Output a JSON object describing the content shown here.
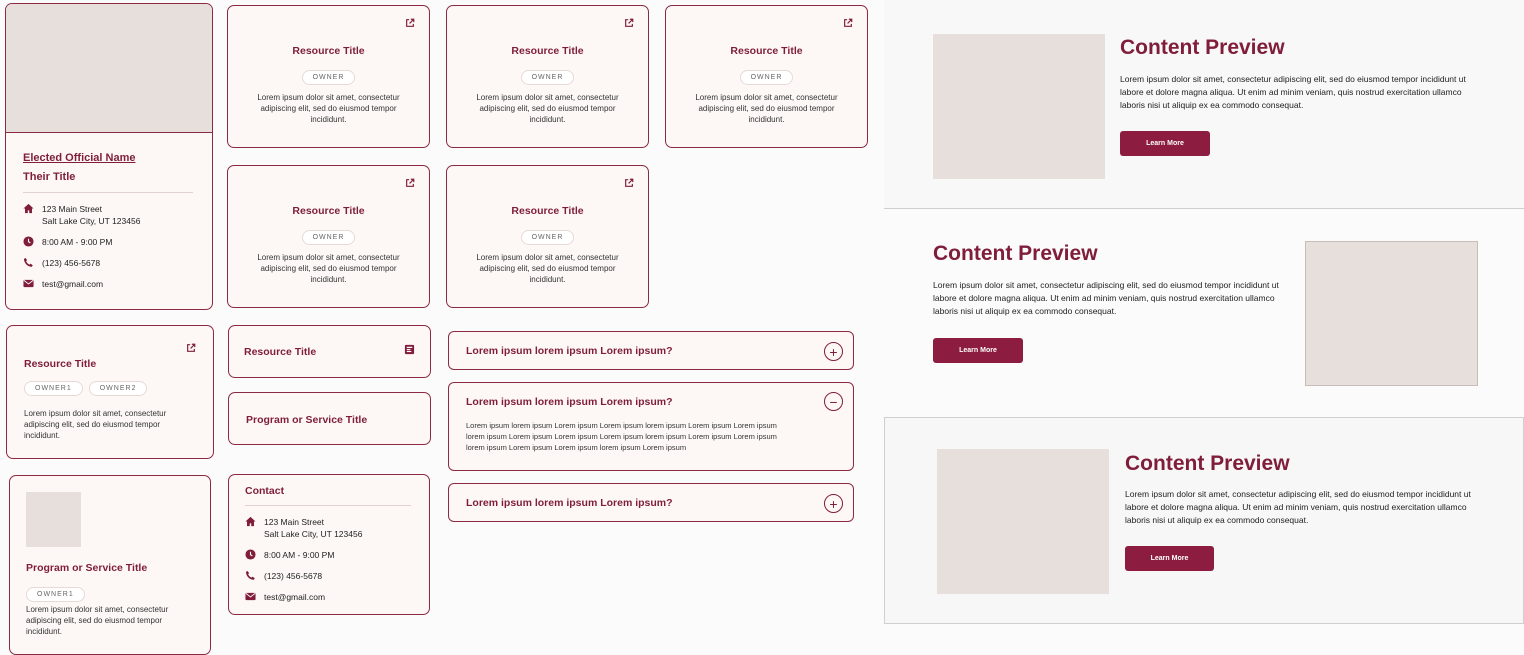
{
  "official": {
    "name": "Elected Official Name",
    "title": "Their Title",
    "address_line1": "123 Main Street",
    "address_line2": "Salt Lake City, UT 123456",
    "hours": "8:00 AM - 9:00 PM",
    "phone": "(123) 456-5678",
    "email": "test@gmail.com"
  },
  "resource_grid": [
    {
      "title": "Resource Title",
      "owner": "OWNER",
      "text": "Lorem ipsum dolor sit amet, consectetur adipiscing elit, sed do eiusmod tempor incididunt."
    },
    {
      "title": "Resource Title",
      "owner": "OWNER",
      "text": "Lorem ipsum dolor sit amet, consectetur adipiscing elit, sed do eiusmod tempor incididunt."
    },
    {
      "title": "Resource Title",
      "owner": "OWNER",
      "text": "Lorem ipsum dolor sit amet, consectetur adipiscing elit, sed do eiusmod tempor incididunt."
    },
    {
      "title": "Resource Title",
      "owner": "OWNER",
      "text": "Lorem ipsum dolor sit amet, consectetur adipiscing elit, sed do eiusmod tempor incididunt."
    },
    {
      "title": "Resource Title",
      "owner": "OWNER",
      "text": "Lorem ipsum dolor sit amet, consectetur adipiscing elit, sed do eiusmod tempor incididunt."
    }
  ],
  "resource_left": {
    "title": "Resource Title",
    "owner1": "OWNER1",
    "owner2": "OWNER2",
    "text": "Lorem ipsum dolor sit amet, consectetur adipiscing elit, sed do eiusmod tempor incididunt."
  },
  "program_card": {
    "title": "Program or Service Title",
    "owner1": "OWNER1",
    "text": "Lorem ipsum dolor sit amet, consectetur adipiscing elit, sed do eiusmod tempor incididunt."
  },
  "resource_small": {
    "title": "Resource Title"
  },
  "program_small": {
    "title": "Program or Service Title"
  },
  "contact": {
    "heading": "Contact",
    "address_line1": "123 Main Street",
    "address_line2": "Salt Lake City, UT 123456",
    "hours": "8:00 AM - 9:00 PM",
    "phone": "(123) 456-5678",
    "email": "test@gmail.com"
  },
  "accordion": [
    {
      "question": "Lorem ipsum lorem ipsum Lorem ipsum?",
      "icon": "+"
    },
    {
      "question": "Lorem ipsum lorem ipsum Lorem ipsum?",
      "icon": "−",
      "answer": "Lorem ipsum lorem ipsum Lorem ipsum Lorem ipsum lorem ipsum Lorem ipsum Lorem ipsum lorem ipsum Lorem ipsum Lorem ipsum Lorem ipsum lorem ipsum Lorem ipsum Lorem ipsum lorem ipsum Lorem ipsum Lorem ipsum lorem ipsum Lorem ipsum"
    },
    {
      "question": "Lorem ipsum lorem ipsum Lorem ipsum?",
      "icon": "+"
    }
  ],
  "content_previews": [
    {
      "title": "Content Preview",
      "text": "Lorem ipsum dolor sit amet, consectetur adipiscing elit, sed do eiusmod tempor incididunt ut labore et dolore magna aliqua. Ut enim ad minim veniam, quis nostrud exercitation ullamco laboris nisi ut aliquip ex ea commodo consequat.",
      "button": "Learn More"
    },
    {
      "title": "Content Preview",
      "text": "Lorem ipsum dolor sit amet, consectetur adipiscing elit, sed do eiusmod tempor incididunt ut labore et dolore magna aliqua. Ut enim ad minim veniam, quis nostrud exercitation ullamco laboris nisi ut aliquip ex ea commodo consequat.",
      "button": "Learn More"
    },
    {
      "title": "Content Preview",
      "text": "Lorem ipsum dolor sit amet, consectetur adipiscing elit, sed do eiusmod tempor incididunt ut labore et dolore magna aliqua. Ut enim ad minim veniam, quis nostrud exercitation ullamco laboris nisi ut aliquip ex ea commodo consequat.",
      "button": "Learn More"
    }
  ],
  "colors": {
    "accent": "#7f1d3a",
    "button": "#8c1d40",
    "placeholder": "#e7dfdc",
    "card_bg": "#fdf8f6"
  }
}
